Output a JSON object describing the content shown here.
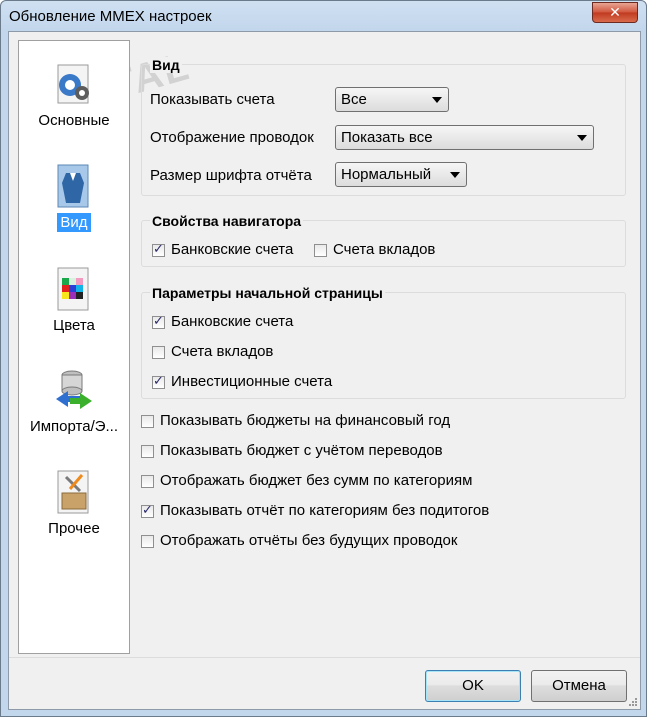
{
  "window": {
    "title": "Обновление MMEX настроек",
    "close_glyph": "✕"
  },
  "watermark": "PORTAL",
  "sidebar": {
    "items": [
      {
        "label": "Основные",
        "icon": "gear-icon",
        "selected": false
      },
      {
        "label": "Вид",
        "icon": "appearance-icon",
        "selected": true
      },
      {
        "label": "Цвета",
        "icon": "palette-icon",
        "selected": false
      },
      {
        "label": "Импорта/Э...",
        "icon": "import-export-icon",
        "selected": false
      },
      {
        "label": "Прочее",
        "icon": "tools-icon",
        "selected": false
      }
    ]
  },
  "view_group": {
    "title": "Вид",
    "show_accounts_label": "Показывать счета",
    "show_accounts_value": "Все",
    "transactions_label": "Отображение проводок",
    "transactions_value": "Показать все",
    "font_size_label": "Размер шрифта отчёта",
    "font_size_value": "Нормальный"
  },
  "navigator_group": {
    "title": "Свойства навигатора",
    "bank_accounts": {
      "label": "Банковские счета",
      "checked": true
    },
    "term_accounts": {
      "label": "Счета вкладов",
      "checked": false
    }
  },
  "home_group": {
    "title": "Параметры начальной страницы",
    "bank_accounts": {
      "label": "Банковские счета",
      "checked": true
    },
    "term_accounts": {
      "label": "Счета вкладов",
      "checked": false
    },
    "investment_accounts": {
      "label": "Инвестиционные счета",
      "checked": true
    }
  },
  "options": [
    {
      "label": "Показывать бюджеты на финансовый год",
      "checked": false
    },
    {
      "label": "Показывать бюджет с учётом переводов",
      "checked": false
    },
    {
      "label": "Отображать бюджет без сумм по категориям",
      "checked": false
    },
    {
      "label": "Показывать отчёт по категориям без подитогов",
      "checked": true
    },
    {
      "label": "Отображать отчёты без будущих проводок",
      "checked": false
    }
  ],
  "buttons": {
    "ok": "OK",
    "cancel": "Отмена"
  }
}
